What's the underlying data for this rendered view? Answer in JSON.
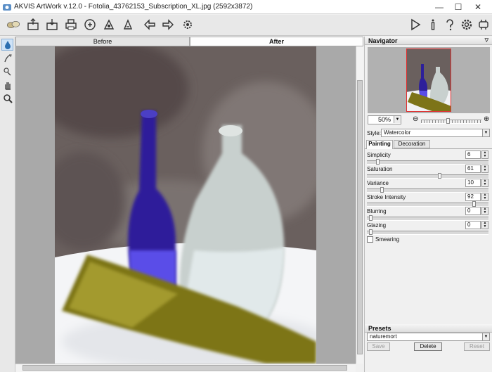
{
  "window": {
    "title": "AKVIS ArtWork v.12.0 - Fotolia_43762153_Subscription_XL.jpg (2592x3872)",
    "minimize": "—",
    "maximize": "☐",
    "close": "✕"
  },
  "view_tabs": {
    "before": "Before",
    "after": "After"
  },
  "navigator": {
    "title": "Navigator",
    "zoom": "50%",
    "zoom_level": 0.45
  },
  "style": {
    "label": "Style:",
    "value": "Watercolor"
  },
  "settings_tabs": {
    "painting": "Painting",
    "decoration": "Decoration"
  },
  "params": [
    {
      "label": "Simplicity",
      "value": "6",
      "level": 0.06
    },
    {
      "label": "Saturation",
      "value": "61",
      "level": 0.61
    },
    {
      "label": "Variance",
      "value": "10",
      "level": 0.1
    },
    {
      "label": "Stroke Intensity",
      "value": "92",
      "level": 0.92
    },
    {
      "label": "Blurring",
      "value": "0",
      "level": 0.0
    },
    {
      "label": "Glazing",
      "value": "0",
      "level": 0.0
    }
  ],
  "smearing": {
    "label": "Smearing",
    "checked": false
  },
  "presets": {
    "title": "Presets",
    "value": "naturemort",
    "save": "Save",
    "delete": "Delete",
    "reset": "Reset"
  },
  "colors": {
    "accent": "#2d6fb0",
    "frame": "#e03030"
  }
}
